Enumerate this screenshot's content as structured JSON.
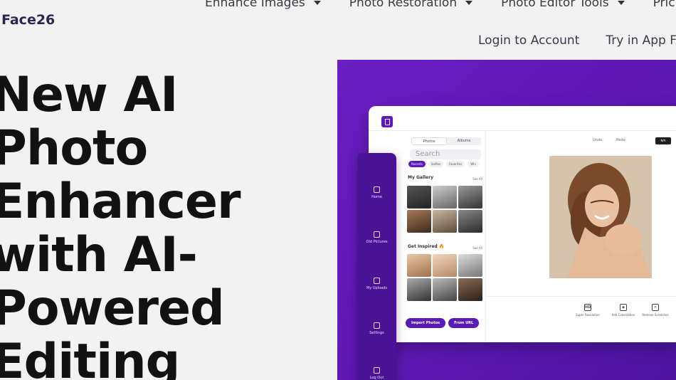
{
  "brand": {
    "logo_text": "Face26"
  },
  "nav": {
    "primary": [
      {
        "label": "Enhance Images"
      },
      {
        "label": "Photo Restoration"
      },
      {
        "label": "Photo Editor Tools"
      },
      {
        "label": "Pric"
      }
    ],
    "login_label": "Login to Account",
    "try_label": "Try in App Fr"
  },
  "hero": {
    "lines": [
      "New AI",
      "Photo",
      "Enhancer",
      "with AI-",
      "Powered",
      "Editing"
    ]
  },
  "app": {
    "sidebar": [
      {
        "label": "Home",
        "icon": "home-icon"
      },
      {
        "label": "Old Pictures",
        "icon": "pictures-icon"
      },
      {
        "label": "My Uploads",
        "icon": "upload-icon"
      },
      {
        "label": "Settings",
        "icon": "gear-icon"
      },
      {
        "label": "Log Out",
        "icon": "logout-icon"
      }
    ],
    "tabs": [
      "Photos",
      "Albums"
    ],
    "search_placeholder": "Search",
    "filters": [
      "Recents",
      "Selfies",
      "Favorites",
      "Whi"
    ],
    "gallery_title": "My Gallery",
    "inspired_title": "Get Inspired 🔥",
    "see_all": "See All",
    "import_label": "Import Photos",
    "url_label": "From URL",
    "undo_label": "Undo",
    "redo_label": "Redo",
    "save_label": "N/A",
    "tools": [
      {
        "label": "Super Resolution",
        "glyph": "HD"
      },
      {
        "label": "Add Colorization",
        "glyph": "◆"
      },
      {
        "label": "Remove Scratches",
        "glyph": "✕"
      }
    ]
  },
  "colors": {
    "accent": "#5b1bb8",
    "panel": "#6a1ec4",
    "sidebar": "#4a1396"
  }
}
